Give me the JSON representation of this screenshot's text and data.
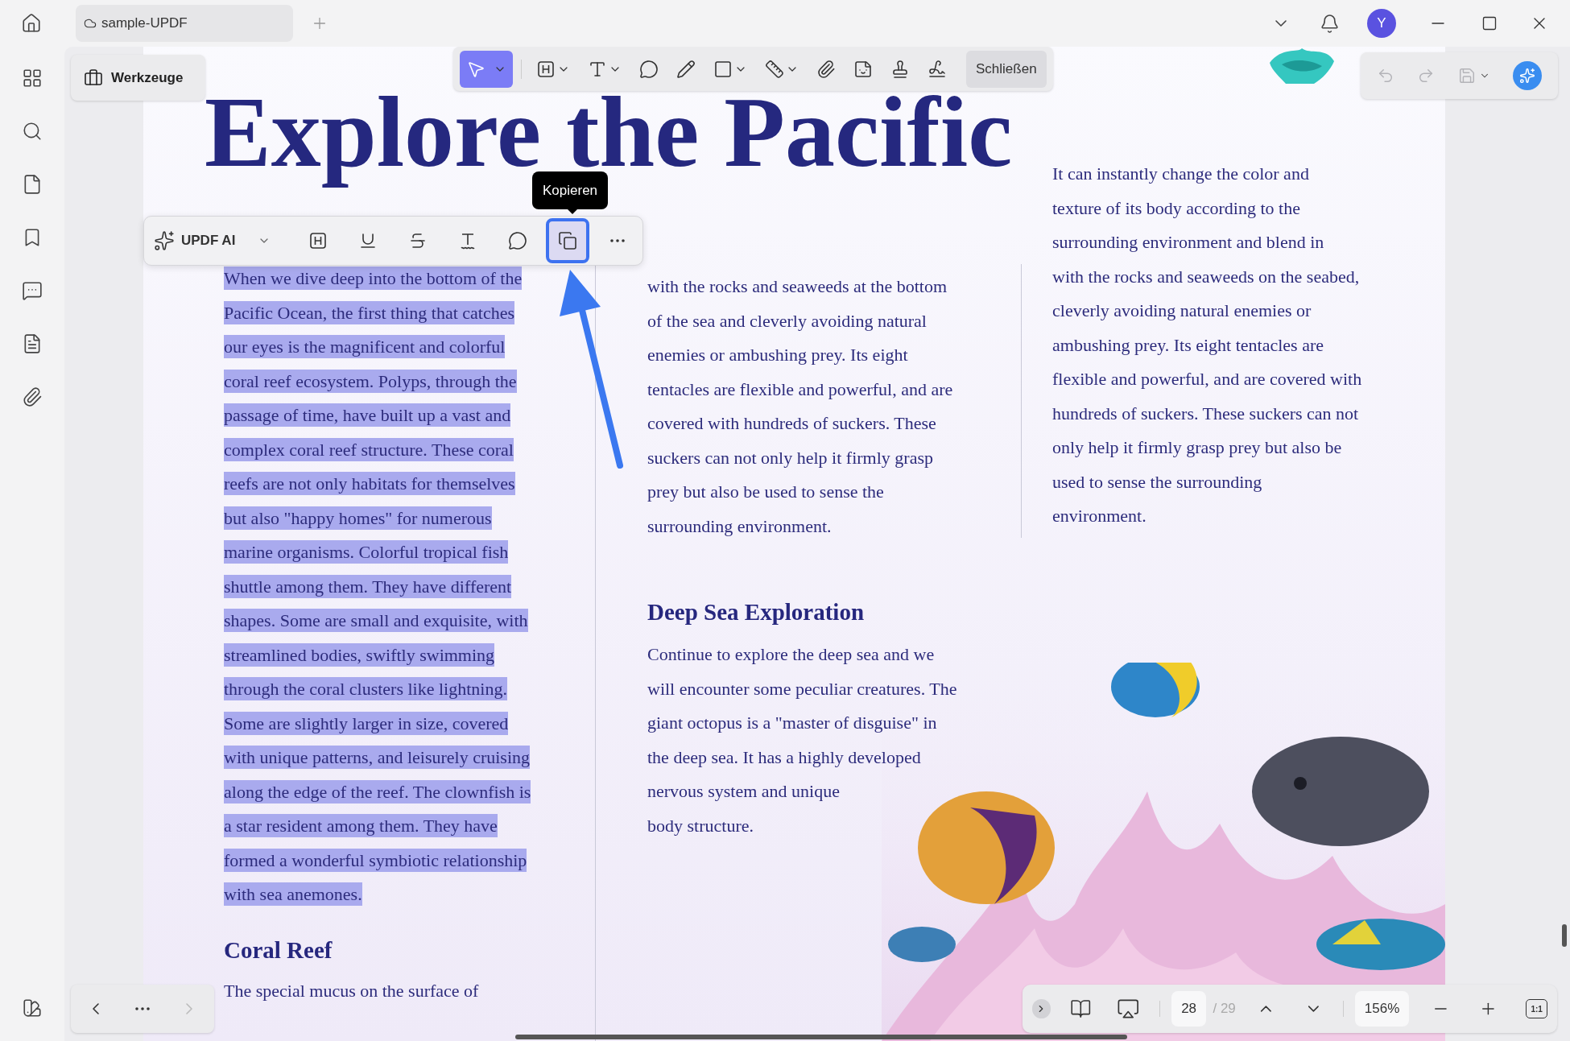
{
  "title_bar": {
    "tab": "sample-UPDF",
    "avatar": "Y"
  },
  "tools_button": "Werkzeuge",
  "toolbar": {
    "tools": [
      {
        "kind": "select",
        "selected": true
      },
      {
        "kind": "highlight",
        "selected": false
      },
      {
        "kind": "text",
        "selected": false
      },
      {
        "kind": "comment",
        "selected": false
      },
      {
        "kind": "pencil",
        "selected": false
      },
      {
        "kind": "shape",
        "selected": false
      },
      {
        "kind": "measure",
        "selected": false
      },
      {
        "kind": "attach",
        "selected": false
      },
      {
        "kind": "sticker",
        "selected": false
      },
      {
        "kind": "stamp",
        "selected": false
      },
      {
        "kind": "signature",
        "selected": false
      }
    ],
    "close": "Schließen"
  },
  "history_toolbar": [
    {
      "kind": "undo",
      "disabled": true
    },
    {
      "kind": "redo",
      "disabled": true
    },
    {
      "kind": "save",
      "disabled": true
    },
    {
      "kind": "ai",
      "disabled": false
    }
  ],
  "selection_toolbar": {
    "ai_label": "UPDF AI",
    "tooltip": "Kopieren",
    "tools": [
      {
        "kind": "highlight",
        "selected": false
      },
      {
        "kind": "underline",
        "selected": false
      },
      {
        "kind": "strikethrough",
        "selected": false
      },
      {
        "kind": "squiggly",
        "selected": false
      },
      {
        "kind": "comment",
        "selected": false
      },
      {
        "kind": "copy",
        "selected": true
      },
      {
        "kind": "more",
        "selected": false
      }
    ]
  },
  "document": {
    "title": "Explore the Pacific",
    "column_1": [
      {
        "kind": "paragraph",
        "selected": true,
        "lines": [
          "When we dive deep into the bottom of the",
          "Pacific Ocean, the first thing that catches",
          "our eyes is the magnificent and colorful",
          "coral reef ecosystem. Polyps, through the",
          "passage of time, have built up a vast and",
          "complex coral reef structure. These coral",
          "reefs are not only habitats for themselves",
          "but also \"happy homes\" for numerous",
          "marine organisms. Colorful tropical fish",
          "shuttle among them. They have different",
          "shapes. Some are small and exquisite, with",
          "streamlined bodies, swiftly swimming",
          "through the coral clusters like lightning.",
          "Some are slightly larger in size, covered",
          "with unique patterns, and leisurely cruising",
          "along the edge of the reef. The clownfish is",
          "a star resident among them. They have",
          "formed a wonderful symbiotic relationship",
          "with sea anemones."
        ]
      },
      {
        "kind": "heading",
        "text": "Coral Reef"
      },
      {
        "kind": "paragraph",
        "selected": false,
        "lines": [
          "The special mucus on the surface of"
        ]
      }
    ],
    "column_2": [
      {
        "kind": "paragraph",
        "selected": false,
        "lines": [
          "with the rocks and seaweeds at the bottom",
          "of the sea and cleverly avoiding natural",
          "enemies or ambushing prey. Its eight",
          "tentacles are flexible and powerful, and are",
          "covered with hundreds of suckers. These",
          "suckers can not only help it firmly grasp",
          "prey but also be used to sense the",
          "surrounding environment."
        ]
      },
      {
        "kind": "heading",
        "text": "Deep Sea Exploration"
      },
      {
        "kind": "paragraph",
        "selected": false,
        "lines": [
          "Continue to explore the deep sea and we",
          "will encounter some peculiar creatures. The",
          "giant octopus is a \"master of disguise\" in",
          "the deep sea. It has a highly developed",
          "nervous system and unique",
          "body structure."
        ]
      }
    ],
    "column_3": [
      {
        "kind": "paragraph",
        "selected": false,
        "lines": [
          "It can instantly change the color and",
          "texture of its body according to the",
          "surrounding environment and blend in",
          "with the rocks and seaweeds on the seabed,",
          "cleverly avoiding natural enemies or",
          "ambushing prey. Its eight tentacles are",
          "flexible and powerful, and are covered with",
          "hundreds of suckers. These suckers can not",
          "only help it firmly grasp prey but also be",
          "used to sense the surrounding",
          "environment."
        ]
      }
    ]
  },
  "page_nav": {
    "previous": {
      "disabled": false
    },
    "next": {
      "disabled": true
    }
  },
  "status_bar": {
    "page": "28",
    "page_count": "/ 29",
    "zoom": "156%",
    "actual_size": "1:1"
  }
}
